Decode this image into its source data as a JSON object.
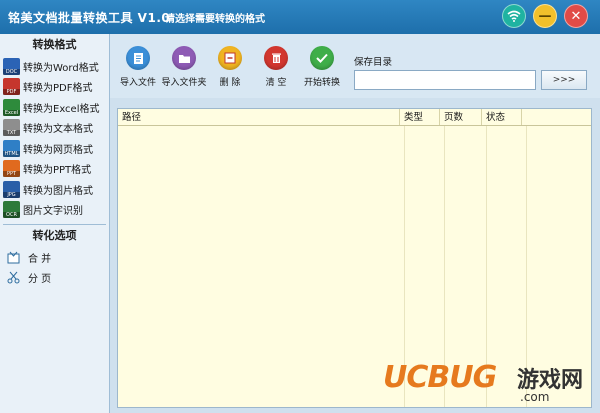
{
  "app": {
    "title": "铭美文档批量转换工具 V1.0",
    "subtitle": "请选择需要转换的格式"
  },
  "window_buttons": {
    "wifi_icon": "wifi-icon",
    "minimize_glyph": "—",
    "close_glyph": "✕"
  },
  "sidebar": {
    "header": "转换格式",
    "items": [
      {
        "label": "转换为Word格式",
        "icon": "doc-icon",
        "badge": "DOC",
        "color": "#2b63b5"
      },
      {
        "label": "转换为PDF格式",
        "icon": "pdf-icon",
        "badge": "PDF",
        "color": "#c6362d"
      },
      {
        "label": "转换为Excel格式",
        "icon": "excel-icon",
        "badge": "Excel",
        "color": "#2e8b3c"
      },
      {
        "label": "转换为文本格式",
        "icon": "txt-icon",
        "badge": "TXT",
        "color": "#8e8e8e"
      },
      {
        "label": "转换为网页格式",
        "icon": "html-icon",
        "badge": "HTML",
        "color": "#2f7fc6"
      },
      {
        "label": "转换为PPT格式",
        "icon": "ppt-icon",
        "badge": "PPT",
        "color": "#e06a1f"
      },
      {
        "label": "转换为图片格式",
        "icon": "jpg-icon",
        "badge": "JPG",
        "color": "#2a5fa8"
      },
      {
        "label": "图片文字识别",
        "icon": "ocr-icon",
        "badge": "OCR",
        "color": "#2d7a3a"
      }
    ],
    "options_header": "转化选项",
    "options": [
      {
        "label": "合 并",
        "icon": "merge-icon"
      },
      {
        "label": "分 页",
        "icon": "split-icon"
      }
    ]
  },
  "toolbar": {
    "import_file": "导入文件",
    "import_folder": "导入文件夹",
    "delete": "删 除",
    "clear": "清 空",
    "start": "开始转换",
    "save_dir_label": "保存目录",
    "save_dir_value": "",
    "browse_label": ">>>",
    "colors": {
      "import_file": "#3b8fd8",
      "import_folder": "#8e5bb5",
      "delete": "#f0b421",
      "clear": "#d2372f",
      "start": "#3fae49"
    }
  },
  "table": {
    "columns": [
      "路径",
      "类型",
      "页数",
      "状态"
    ],
    "rows": []
  },
  "watermark": {
    "logo": "UCBUG",
    "cn": "游戏网",
    "url": ".com"
  }
}
